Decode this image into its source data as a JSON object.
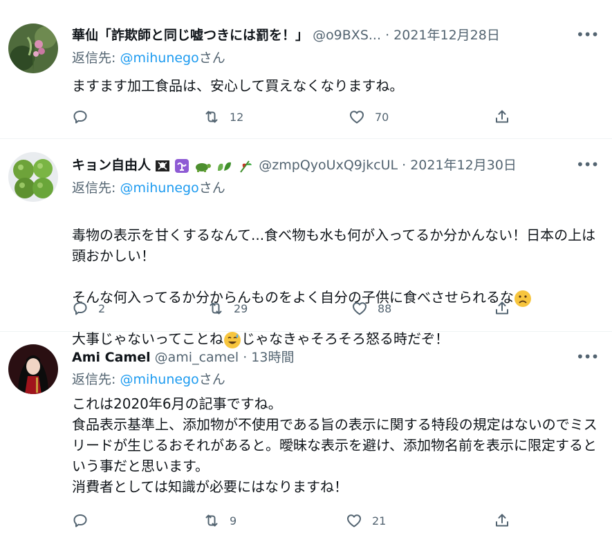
{
  "tweets": [
    {
      "name": "華仙「詐欺師と同じ嘘つきには罰を！」",
      "handle": "@o9BXS...",
      "time": "· 2021年12月28日",
      "reply_prefix": "返信先: ",
      "reply_handle": "@mihunego",
      "reply_suffix": "さん",
      "text": "ますます加工食品は、安心して買えなくなりますね。",
      "reply_count": "",
      "retweet_count": "12",
      "like_count": "70"
    },
    {
      "name": "キョン自由人",
      "handle": "@zmpQyoUxQ9jkcUL",
      "time": "· 2021年12月30日",
      "reply_prefix": "返信先: ",
      "reply_handle": "@mihunego",
      "reply_suffix": "さん",
      "text_line1": "毒物の表示を甘くするなんて...食べ物も水も何が入ってるか分かんない！日本の上は頭おかしい！",
      "text_line2": "そんな何入ってるか分からんものをよく自分の子供に食べさせられるな",
      "text_line3a": "大事じゃないってことね",
      "text_line3b": "じゃなきゃそろそろ怒る時だぞ！",
      "reply_count": "2",
      "retweet_count": "29",
      "like_count": "88"
    },
    {
      "name": "Ami Camel",
      "handle": "@ami_camel",
      "time": "· 13時間",
      "reply_prefix": "返信先: ",
      "reply_handle": "@mihunego",
      "reply_suffix": "さん",
      "text": "これは2020年6月の記事ですね。\n食品表示基準上、添加物が不使用である旨の表示に関する特段の規定はないのでミスリードが生じるおそれがあると。曖昧な表示を避け、添加物名前を表示に限定するという事だと思います。\n消費者としては知識が必要にはなりますね！",
      "reply_count": "",
      "retweet_count": "9",
      "like_count": "21"
    }
  ],
  "icons": {
    "reply": "reply-icon",
    "retweet": "retweet-icon",
    "like": "heart-icon",
    "share": "share-icon",
    "more": "more-icon"
  },
  "colors": {
    "link": "#1d9bf0",
    "muted": "#536471",
    "text": "#0f1419",
    "divider": "#eff3f4"
  }
}
